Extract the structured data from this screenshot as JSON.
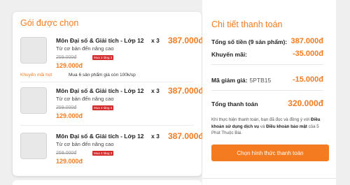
{
  "selected_packages": {
    "title": "Gói được chọn",
    "items": [
      {
        "name": "Môn Đại số & Giải tích - Lớp 12",
        "qty": "x 3",
        "price": "387.000đ",
        "desc": "Từ cơ bản đến nâng cao",
        "old_price": "259.000đ",
        "badge": "Mua 3 tặng 3",
        "new_price": "129.000đ",
        "promo_tag": "Khuyến mãi hot",
        "promo_text": "Mua 6 sản phẩm giá còn 100k/sp"
      },
      {
        "name": "Môn Đại số & Giải tích - Lớp 12",
        "qty": "x 3",
        "price": "387.000đ",
        "desc": "Từ cơ bản đến nâng cao",
        "old_price": "259.000đ",
        "badge": "Mua 3 tặng 3",
        "new_price": "129.000đ"
      },
      {
        "name": "Môn Đại số & Giải tích - Lớp 12",
        "qty": "x 3",
        "price": "387.000đ",
        "desc": "Từ cơ bản đến nâng cao",
        "old_price": "259.000đ",
        "badge": "Mua 3 tặng 3",
        "new_price": "129.000đ"
      }
    ]
  },
  "payment": {
    "title": "Chi tiết thanh toán",
    "total_label": "Tổng số tiền (9 sản phẩm):",
    "total_value": "387.000đ",
    "discount_label": "Khuyến mãi:",
    "discount_value": "-35.000đ",
    "coupon_label": "Mã giảm giá:",
    "coupon_code": "5PTB15",
    "coupon_value": "-15.000đ",
    "grand_label": "Tổng thanh toán",
    "grand_value": "320.000đ",
    "note_pre": "Khi thực hiện thanh toán, bạn đã đọc và đồng ý với ",
    "note_terms": "Điều khoản sử dụng dịch vụ",
    "note_and": " và ",
    "note_privacy": "Điều khoản bảo mật",
    "note_post": " của 5 Phút Thuộc Bài.",
    "button": "Chọn hình thức thanh toán"
  },
  "colors": {
    "accent": "#f47b20",
    "badge": "#d42a2a",
    "background": "#efefef"
  }
}
